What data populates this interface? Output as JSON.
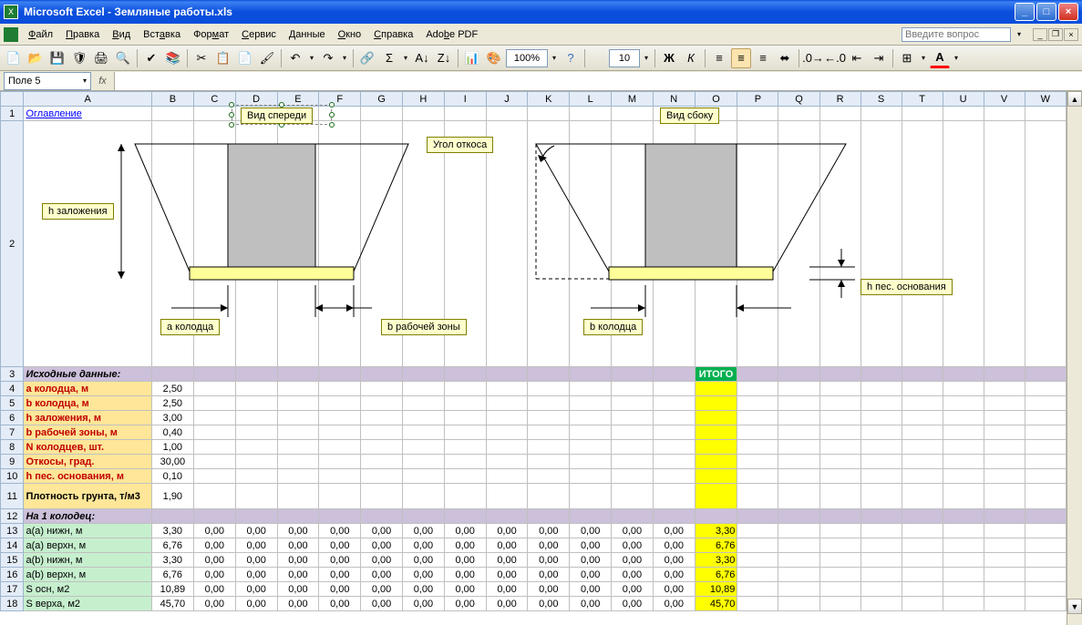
{
  "window": {
    "title": "Microsoft Excel - Земляные работы.xls",
    "help_placeholder": "Введите вопрос"
  },
  "menu": [
    "Файл",
    "Правка",
    "Вид",
    "Вставка",
    "Формат",
    "Сервис",
    "Данные",
    "Окно",
    "Справка",
    "Adobe PDF"
  ],
  "formula": {
    "namebox": "Поле 5",
    "fx": "fx",
    "value": ""
  },
  "zoom": "100%",
  "fontsize": "10",
  "columns": [
    "A",
    "B",
    "C",
    "D",
    "E",
    "F",
    "G",
    "H",
    "I",
    "J",
    "K",
    "L",
    "M",
    "N",
    "O",
    "P",
    "Q",
    "R",
    "S",
    "T",
    "U",
    "V",
    "W"
  ],
  "rows_visible": [
    "1",
    "2",
    "3",
    "4",
    "5",
    "6",
    "7",
    "8",
    "9",
    "10",
    "11",
    "12",
    "13",
    "14",
    "15",
    "16",
    "17",
    "18"
  ],
  "cells": {
    "A1": "Оглавление",
    "A3": "Исходные данные:",
    "O3": "ИТОГО",
    "A4": "a колодца, м",
    "B4": "2,50",
    "A5": "b колодца, м",
    "B5": "2,50",
    "A6": "h заложения, м",
    "B6": "3,00",
    "A7": "b рабочей зоны, м",
    "B7": "0,40",
    "A8": "N колодцев, шт.",
    "B8": "1,00",
    "A9": "Откосы, град.",
    "B9": "30,00",
    "A10": "h пес. основания, м",
    "B10": "0,10",
    "A11": "Плотность грунта, т/м3",
    "B11": "1,90",
    "A12": "На 1 колодец:",
    "A13": "a(a) нижн, м",
    "B13": "3,30",
    "C13": "0,00",
    "D13": "0,00",
    "E13": "0,00",
    "F13": "0,00",
    "G13": "0,00",
    "H13": "0,00",
    "I13": "0,00",
    "J13": "0,00",
    "K13": "0,00",
    "L13": "0,00",
    "M13": "0,00",
    "N13": "0,00",
    "O13": "3,30",
    "A14": "a(a) верхн, м",
    "B14": "6,76",
    "C14": "0,00",
    "D14": "0,00",
    "E14": "0,00",
    "F14": "0,00",
    "G14": "0,00",
    "H14": "0,00",
    "I14": "0,00",
    "J14": "0,00",
    "K14": "0,00",
    "L14": "0,00",
    "M14": "0,00",
    "N14": "0,00",
    "O14": "6,76",
    "A15": "a(b) нижн, м",
    "B15": "3,30",
    "C15": "0,00",
    "D15": "0,00",
    "E15": "0,00",
    "F15": "0,00",
    "G15": "0,00",
    "H15": "0,00",
    "I15": "0,00",
    "J15": "0,00",
    "K15": "0,00",
    "L15": "0,00",
    "M15": "0,00",
    "N15": "0,00",
    "O15": "3,30",
    "A16": "a(b) верхн, м",
    "B16": "6,76",
    "C16": "0,00",
    "D16": "0,00",
    "E16": "0,00",
    "F16": "0,00",
    "G16": "0,00",
    "H16": "0,00",
    "I16": "0,00",
    "J16": "0,00",
    "K16": "0,00",
    "L16": "0,00",
    "M16": "0,00",
    "N16": "0,00",
    "O16": "6,76",
    "A17": "S осн, м2",
    "B17": "10,89",
    "C17": "0,00",
    "D17": "0,00",
    "E17": "0,00",
    "F17": "0,00",
    "G17": "0,00",
    "H17": "0,00",
    "I17": "0,00",
    "J17": "0,00",
    "K17": "0,00",
    "L17": "0,00",
    "M17": "0,00",
    "N17": "0,00",
    "O17": "10,89",
    "A18": "S верха, м2",
    "B18": "45,70",
    "C18": "0,00",
    "D18": "0,00",
    "E18": "0,00",
    "F18": "0,00",
    "G18": "0,00",
    "H18": "0,00",
    "I18": "0,00",
    "J18": "0,00",
    "K18": "0,00",
    "L18": "0,00",
    "M18": "0,00",
    "N18": "0,00",
    "O18": "45,70"
  },
  "diagram": {
    "tag_front": "Вид спереди",
    "tag_side": "Вид сбоку",
    "tag_h": "h заложения",
    "tag_a": "a колодца",
    "tag_brab": "b рабочей зоны",
    "tag_angle": "Угол откоса",
    "tag_bkol": "b колодца",
    "tag_hpes": "h пес. основания"
  }
}
